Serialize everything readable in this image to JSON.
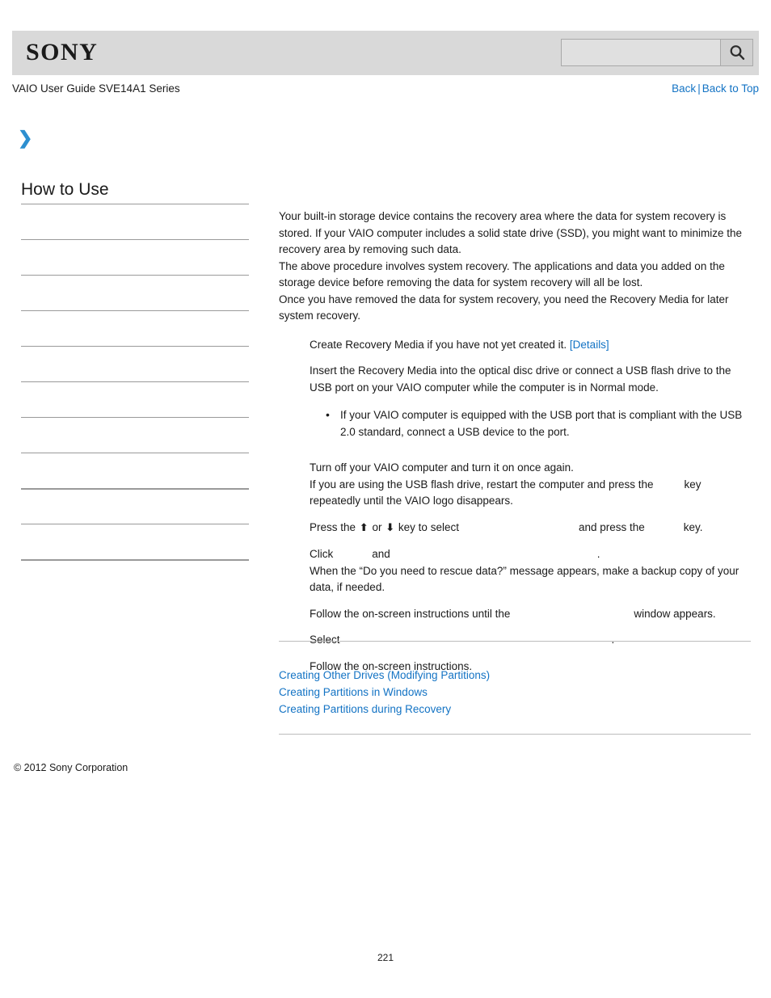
{
  "header": {
    "logo_text": "SONY",
    "search": {
      "value": "",
      "placeholder": "",
      "button_icon": "search-icon"
    }
  },
  "subheader": {
    "guide_title": "VAIO User Guide SVE14A1 Series",
    "back_label": "Back",
    "separator": "|",
    "back_to_top_label": "Back to Top"
  },
  "chevron_icon": "❯",
  "sidebar": {
    "title": "How to Use",
    "items": [
      {
        "label": ""
      },
      {
        "label": ""
      },
      {
        "label": ""
      },
      {
        "label": ""
      },
      {
        "label": ""
      },
      {
        "label": ""
      },
      {
        "label": ""
      },
      {
        "label": ""
      },
      {
        "label": ""
      },
      {
        "label": ""
      },
      {
        "label": ""
      }
    ]
  },
  "content": {
    "intro": [
      "Your built-in storage device contains the recovery area where the data for system recovery is stored. If your VAIO computer includes a solid state drive (SSD), you might want to minimize the recovery area by removing such data.",
      "The above procedure involves system recovery. The applications and data you added on the storage device before removing the data for system recovery will all be lost.",
      "Once you have removed the data for system recovery, you need the Recovery Media for later system recovery."
    ],
    "steps": [
      {
        "text_before": "Create Recovery Media if you have not yet created it. ",
        "link": "[Details]",
        "text_after": ""
      },
      {
        "text_before": "Insert the Recovery Media into the optical disc drive or connect a USB flash drive to the USB port on your VAIO computer while the computer is in Normal mode.",
        "note": "If your VAIO computer is equipped with the USB port that is compliant with the USB 2.0 standard, connect a USB device to the port."
      },
      {
        "line1": "Turn off your VAIO computer and turn it on once again.",
        "line2_a": "If you are using the USB flash drive, restart the computer and press the",
        "line2_gap": 38,
        "line2_b": "key repeatedly until the VAIO logo disappears."
      },
      {
        "a": "Press the",
        "arrow_up": "⬆",
        "or": "or",
        "arrow_down": "⬇",
        "b": "key to select",
        "gap1": 148,
        "c": "and press the",
        "gap2": 48,
        "d": "key."
      },
      {
        "line1_a": "Click",
        "line1_gap1": 48,
        "line1_b": "and",
        "line1_gap2": 256,
        "line1_c": ".",
        "line2": "When the “Do you need to rescue data?” message appears, make a backup copy of your data, if needed."
      },
      {
        "a": "Follow the on-screen instructions until the",
        "gap": 153,
        "b": "window appears."
      },
      {
        "a": "Select",
        "gap": 336,
        "b": "."
      },
      {
        "a": "Follow the on-screen instructions."
      }
    ]
  },
  "related_links": [
    "Creating Other Drives (Modifying Partitions)",
    "Creating Partitions in Windows",
    "Creating Partitions during Recovery"
  ],
  "footer": {
    "copyright": "© 2012 Sony Corporation",
    "page_number": "221"
  },
  "colors": {
    "link": "#1373c4",
    "header_bg": "#d9d9d9",
    "chevron": "#2d8fd0",
    "rule": "#9a9a9a"
  }
}
